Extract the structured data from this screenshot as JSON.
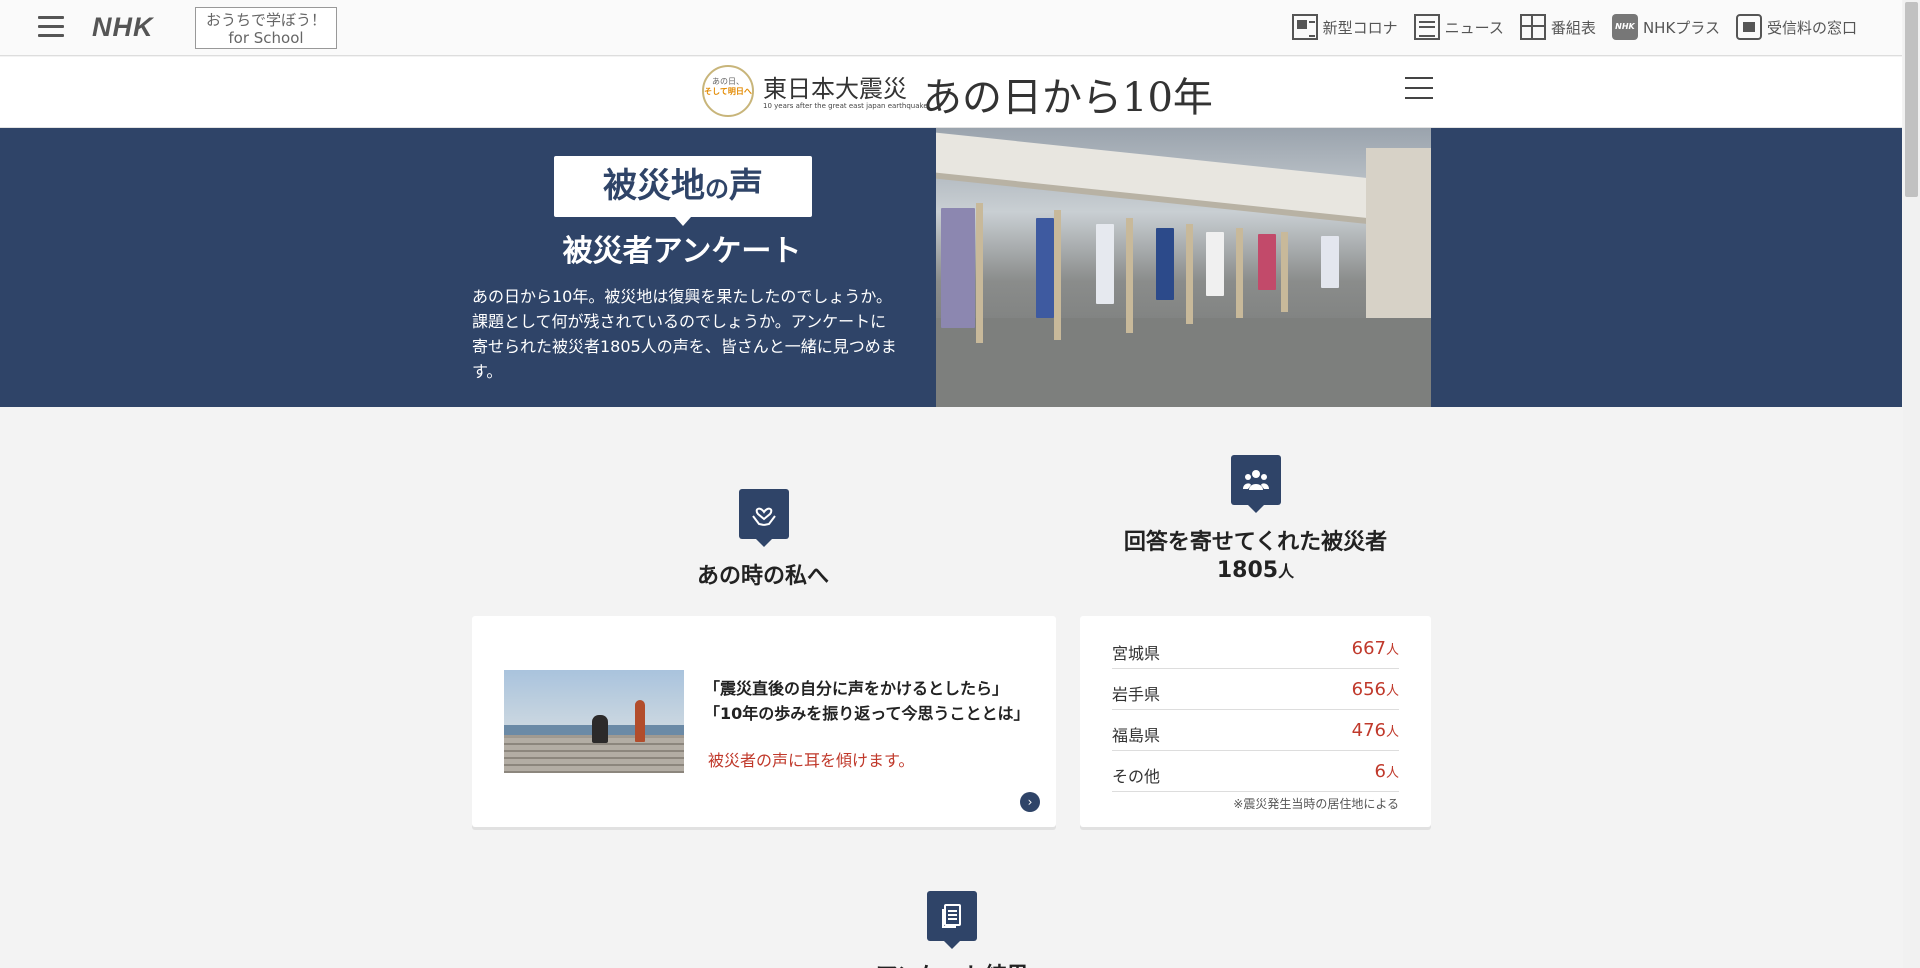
{
  "topbar": {
    "brand": "NHK",
    "school_line1": "おうちで学ぼう！",
    "school_line2": "for School",
    "nav": [
      {
        "label": "新型コロナ",
        "icon": "corona-icon"
      },
      {
        "label": "ニュース",
        "icon": "news-icon"
      },
      {
        "label": "番組表",
        "icon": "program-guide-icon"
      },
      {
        "label": "NHKプラス",
        "icon": "nhk-plus-icon"
      },
      {
        "label": "受信料の窓口",
        "icon": "reception-fee-icon"
      }
    ],
    "plus_icon_text": "NHK"
  },
  "site_header": {
    "badge_line1": "あの日、",
    "badge_line2": "そして明日へ",
    "title": "東日本大震災",
    "subtitle": "10 years after the great east japan earthquake",
    "big_title": "あの日から10年"
  },
  "hero": {
    "label_main": "被災地",
    "label_small": "の",
    "label_end": "声",
    "subtitle": "被災者アンケート",
    "description": "あの日から10年。被災地は復興を果たしたのでしょうか。課題として何が残されているのでしょうか。アンケートに寄せられた被災者1805人の声を、皆さんと一緒に見つめます。"
  },
  "sections": {
    "letter_title": "あの時の私へ",
    "respondents_line1": "回答を寄せてくれた被災者",
    "respondents_total": "1805",
    "respondents_unit": "人",
    "results_title": "アンケート結果"
  },
  "letter_card": {
    "q1": "「震災直後の自分に声をかけるとしたら」",
    "q2": "「10年の歩みを振り返って今思うこととは」",
    "note": "被災者の声に耳を傾けます。",
    "arrow": "›"
  },
  "stats": {
    "rows": [
      {
        "pref": "宮城県",
        "count": "667",
        "unit": "人"
      },
      {
        "pref": "岩手県",
        "count": "656",
        "unit": "人"
      },
      {
        "pref": "福島県",
        "count": "476",
        "unit": "人"
      },
      {
        "pref": "その他",
        "count": "6",
        "unit": "人"
      }
    ],
    "footnote": "※震災発生当時の居住地による"
  },
  "colors": {
    "navy": "#2f4468",
    "accent_red": "#c0392b"
  }
}
